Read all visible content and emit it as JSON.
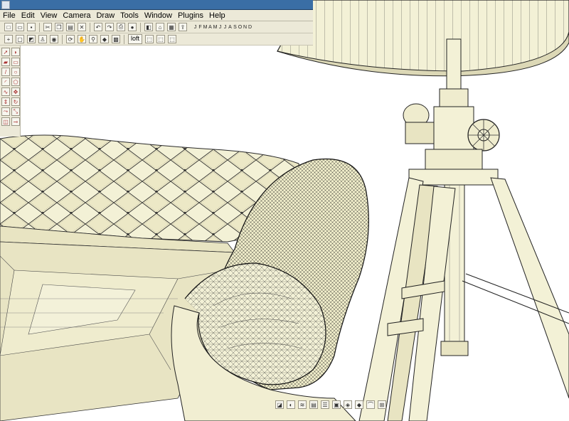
{
  "app": {
    "icon": "sketchup-logo-icon"
  },
  "menu": {
    "items": [
      {
        "label": "File"
      },
      {
        "label": "Edit"
      },
      {
        "label": "View"
      },
      {
        "label": "Camera"
      },
      {
        "label": "Draw"
      },
      {
        "label": "Tools"
      },
      {
        "label": "Window"
      },
      {
        "label": "Plugins"
      },
      {
        "label": "Help"
      }
    ]
  },
  "toolbar": {
    "row1_icons": [
      "new-icon",
      "open-icon",
      "save-icon",
      "cut-icon",
      "copy-icon",
      "paste-icon",
      "erase-icon",
      "undo-icon",
      "redo-icon",
      "print-icon",
      "user-icon",
      "component-icon",
      "house-icon",
      "warehouse-icon",
      "share-icon"
    ],
    "months": [
      "J",
      "F",
      "M",
      "A",
      "M",
      "J",
      "J",
      "A",
      "S",
      "O",
      "N",
      "D"
    ],
    "row2_icons": [
      "axis-icon",
      "box-icon",
      "cube-icon",
      "walk-icon",
      "camera-icon",
      "orbit-icon",
      "pan-icon",
      "zoom-icon",
      "styles-icon",
      "sandbox-icon"
    ],
    "loft_label": "loft"
  },
  "tools": [
    "select-icon",
    "paint-icon",
    "eraser-icon",
    "rectangle-icon",
    "line-icon",
    "circle-icon",
    "arc-icon",
    "polygon-icon",
    "freehand-icon",
    "move-icon",
    "push-pull-icon",
    "rotate-icon",
    "follow-me-icon",
    "scale-icon",
    "offset-icon",
    "tape-icon"
  ],
  "bottom_toolbar": [
    "section-icon",
    "shadow-icon",
    "fog-icon",
    "layer-icon",
    "outliner-icon",
    "scene-icon",
    "material-icon",
    "ruby-icon",
    "softedge-icon",
    "photo-match-icon"
  ],
  "colors": {
    "model_fill": "#f3f1d6",
    "model_shade": "#d9d6b2",
    "edge": "#2a2a2a",
    "chrome": "#ece9d8"
  },
  "scene": {
    "description_icon": "3d-model-viewport"
  }
}
